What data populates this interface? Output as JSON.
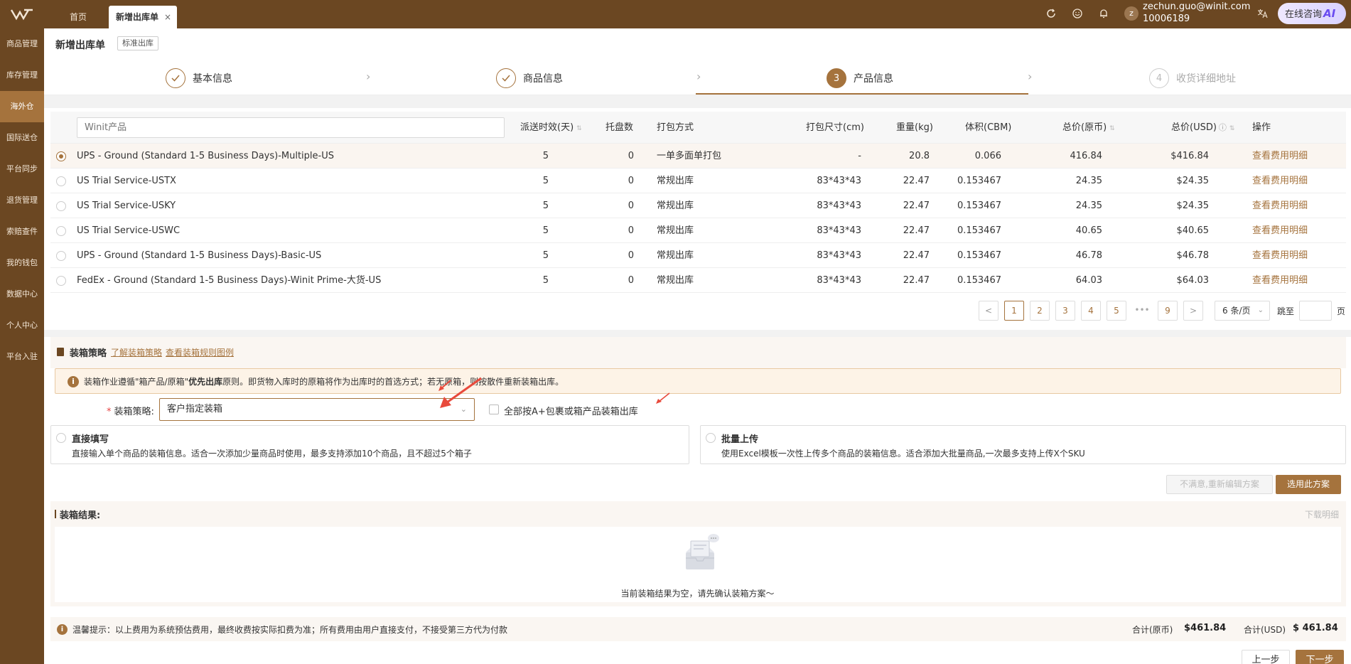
{
  "header": {
    "tabs": [
      {
        "label": "首页",
        "active": false
      },
      {
        "label": "新增出库单",
        "active": true
      }
    ],
    "close_glyph": "×",
    "user": {
      "avatar_letter": "z",
      "email": "zechun.guo@winit.com",
      "id": "10006189"
    },
    "ai_button": {
      "label": "在线咨询",
      "badge": "AI"
    },
    "icons": [
      "refresh-icon",
      "smile-icon",
      "bell-icon",
      "translate-icon"
    ]
  },
  "sidebar": {
    "items": [
      {
        "label": "商品管理",
        "active": false
      },
      {
        "label": "库存管理",
        "active": false
      },
      {
        "label": "海外仓",
        "active": true
      },
      {
        "label": "国际送仓",
        "active": false
      },
      {
        "label": "平台同步",
        "active": false
      },
      {
        "label": "退货管理",
        "active": false
      },
      {
        "label": "索赔查件",
        "active": false
      },
      {
        "label": "我的钱包",
        "active": false
      },
      {
        "label": "数据中心",
        "active": false
      },
      {
        "label": "个人中心",
        "active": false
      },
      {
        "label": "平台入驻",
        "active": false
      }
    ]
  },
  "page": {
    "title": "新增出库单",
    "tag": "标准出库"
  },
  "steps": [
    {
      "index": "1",
      "label": "基本信息",
      "state": "done"
    },
    {
      "index": "2",
      "label": "商品信息",
      "state": "done"
    },
    {
      "index": "3",
      "label": "产品信息",
      "state": "current"
    },
    {
      "index": "4",
      "label": "收货详细地址",
      "state": "todo"
    }
  ],
  "table": {
    "search_placeholder": "Winit产品",
    "columns": [
      "派送时效(天)",
      "托盘数",
      "打包方式",
      "打包尺寸(cm)",
      "重量(kg)",
      "体积(CBM)",
      "总价(原币)",
      "总价(USD)",
      "操作"
    ],
    "rows": [
      {
        "selected": true,
        "product": "UPS - Ground (Standard 1-5 Business Days)-Multiple-US",
        "days": "5",
        "pallets": "0",
        "pack": "一单多面单打包",
        "size": "-",
        "weight": "20.8",
        "volume": "0.066",
        "price": "416.84",
        "usd": "$416.84",
        "action": "查看费用明细"
      },
      {
        "selected": false,
        "product": "US Trial Service-USTX",
        "days": "5",
        "pallets": "0",
        "pack": "常规出库",
        "size": "83*43*43",
        "weight": "22.47",
        "volume": "0.153467",
        "price": "24.35",
        "usd": "$24.35",
        "action": "查看费用明细"
      },
      {
        "selected": false,
        "product": "US Trial Service-USKY",
        "days": "5",
        "pallets": "0",
        "pack": "常规出库",
        "size": "83*43*43",
        "weight": "22.47",
        "volume": "0.153467",
        "price": "24.35",
        "usd": "$24.35",
        "action": "查看费用明细"
      },
      {
        "selected": false,
        "product": "US Trial Service-USWC",
        "days": "5",
        "pallets": "0",
        "pack": "常规出库",
        "size": "83*43*43",
        "weight": "22.47",
        "volume": "0.153467",
        "price": "40.65",
        "usd": "$40.65",
        "action": "查看费用明细"
      },
      {
        "selected": false,
        "product": "UPS - Ground (Standard 1-5 Business Days)-Basic-US",
        "days": "5",
        "pallets": "0",
        "pack": "常规出库",
        "size": "83*43*43",
        "weight": "22.47",
        "volume": "0.153467",
        "price": "46.78",
        "usd": "$46.78",
        "action": "查看费用明细"
      },
      {
        "selected": false,
        "product": "FedEx - Ground (Standard 1-5 Business Days)-Winit Prime-大货-US",
        "days": "5",
        "pallets": "0",
        "pack": "常规出库",
        "size": "83*43*43",
        "weight": "22.47",
        "volume": "0.153467",
        "price": "64.03",
        "usd": "$64.03",
        "action": "查看费用明细"
      }
    ]
  },
  "pagination": {
    "prev": "<",
    "next": ">",
    "pages": [
      "1",
      "2",
      "3",
      "4",
      "5"
    ],
    "ellipsis": "•••",
    "last": "9",
    "current": "1",
    "page_size": "6 条/页",
    "jump_label": "跳至",
    "page_suffix": "页"
  },
  "packing": {
    "title": "装箱策略",
    "link_learn": "了解装箱策略",
    "link_rules": "查看装箱规则图例",
    "notice_icon": "i",
    "notice_pre": "装箱作业遵循\"箱产品/原箱\"",
    "notice_bold": "优先出库",
    "notice_post": "原则。即货物入库时的原箱将作为出库时的首选方式；若无原箱，则按散件重新装箱出库。",
    "strategy_label": "装箱策略:",
    "strategy_value": "客户指定装箱",
    "checkbox_label": "全部按A+包裹或箱产品装箱出库",
    "options": [
      {
        "title": "直接填写",
        "desc": "直接输入单个商品的装箱信息。适合一次添加少量商品时使用，最多支持添加10个商品，且不超过5个箱子"
      },
      {
        "title": "批量上传",
        "desc": "使用Excel模板一次性上传多个商品的装箱信息。适合添加大批量商品,一次最多支持上传X个SKU"
      }
    ],
    "btn_reedit": "不满意,重新编辑方案",
    "btn_select": "选用此方案"
  },
  "result": {
    "title": "装箱结果:",
    "download": "下载明细",
    "empty": "当前装箱结果为空，请先确认装箱方案～"
  },
  "footer": {
    "tip": "温馨提示：以上费用为系统预估费用，最终收费按实际扣费为准；所有费用由用户直接支付，不接受第三方代为付款",
    "total_orig_label": "合计(原币)",
    "total_orig": "$461.84",
    "total_usd_label": "合计(USD)",
    "total_usd": "$ 461.84",
    "btn_prev": "上一步",
    "btn_next": "下一步"
  },
  "colors": {
    "brand": "#6b4722",
    "accent": "#a5733d",
    "alert": "#e64545"
  }
}
